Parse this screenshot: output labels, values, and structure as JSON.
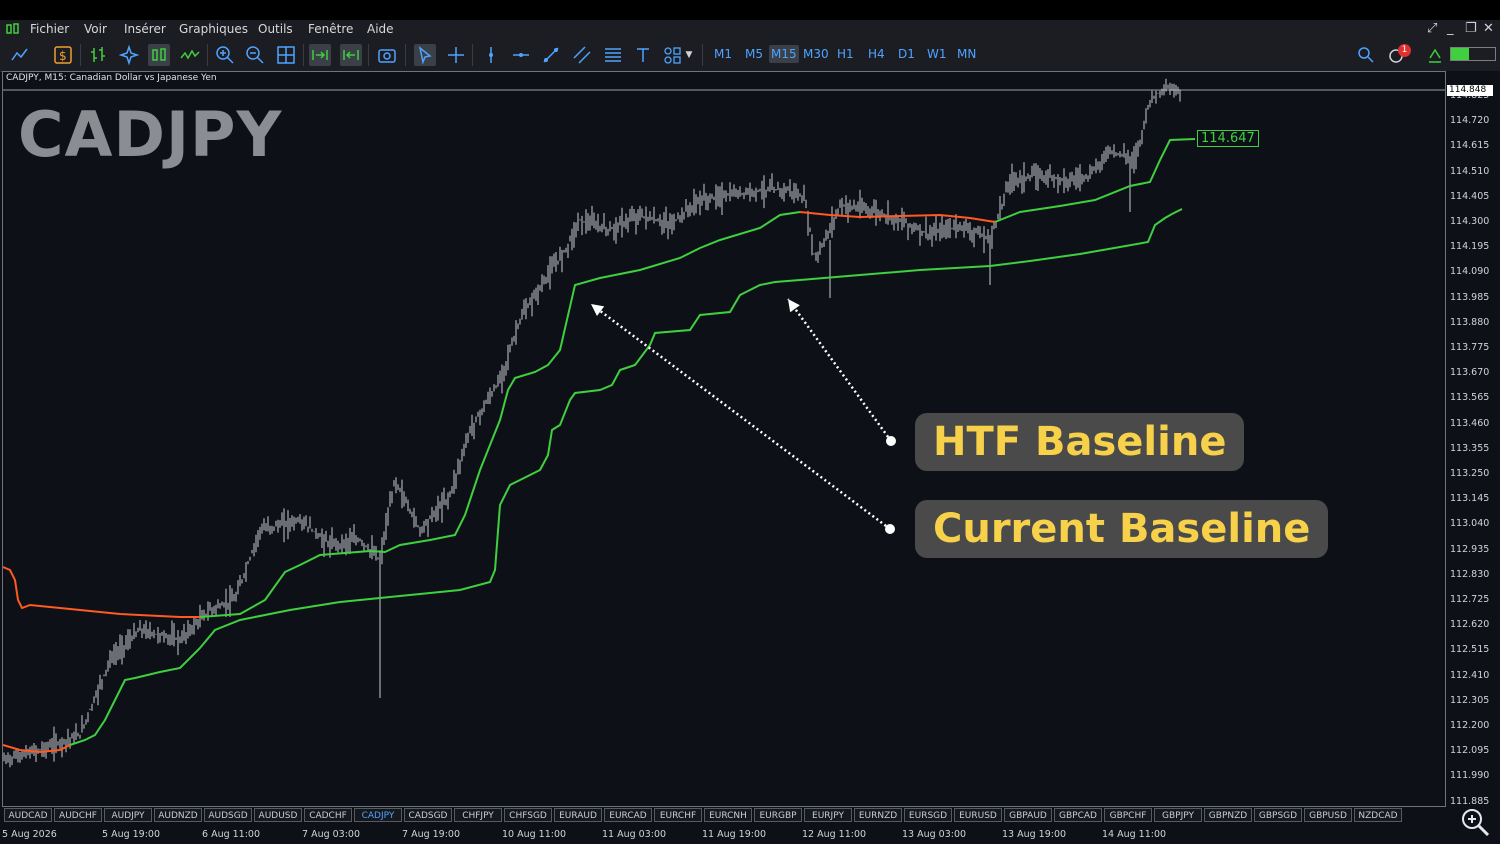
{
  "menu": [
    "Fichier",
    "Voir",
    "Insérer",
    "Graphiques",
    "Outils",
    "Fenêtre",
    "Aide"
  ],
  "timeframes": [
    "M1",
    "M5",
    "M15",
    "M30",
    "H1",
    "H4",
    "D1",
    "W1",
    "MN"
  ],
  "active_timeframe": "M15",
  "notification_count": "1",
  "chart": {
    "info": "CADJPY, M15:  Canadian Dollar vs Japanese Yen",
    "symbol": "CADJPY",
    "current_price": "114.848",
    "baseline_value": "114.647",
    "htf_label": "HTF Baseline",
    "current_label": "Current Baseline"
  },
  "price_axis": [
    "114.825",
    "114.720",
    "114.615",
    "114.510",
    "114.405",
    "114.300",
    "114.195",
    "114.090",
    "113.985",
    "113.880",
    "113.775",
    "113.670",
    "113.565",
    "113.460",
    "113.355",
    "113.250",
    "113.145",
    "113.040",
    "112.935",
    "112.830",
    "112.725",
    "112.620",
    "112.515",
    "112.410",
    "112.305",
    "112.200",
    "112.095",
    "111.990",
    "111.885"
  ],
  "time_axis": [
    "5 Aug 2026",
    "5 Aug 19:00",
    "6 Aug 11:00",
    "7 Aug 03:00",
    "7 Aug 19:00",
    "10 Aug 11:00",
    "11 Aug 03:00",
    "11 Aug 19:00",
    "12 Aug 11:00",
    "13 Aug 03:00",
    "13 Aug 19:00",
    "14 Aug 11:00"
  ],
  "symbol_tabs": [
    "AUDCAD",
    "AUDCHF",
    "AUDJPY",
    "AUDNZD",
    "AUDSGD",
    "AUDUSD",
    "CADCHF",
    "CADJPY",
    "CADSGD",
    "CHFJPY",
    "CHFSGD",
    "EURAUD",
    "EURCAD",
    "EURCHF",
    "EURCNH",
    "EURGBP",
    "EURJPY",
    "EURNZD",
    "EURSGD",
    "EURUSD",
    "GBPAUD",
    "GBPCAD",
    "GBPCHF",
    "GBPJPY",
    "GBPNZD",
    "GBPSGD",
    "GBPUSD",
    "NZDCAD"
  ],
  "active_tab": "CADJPY",
  "colors": {
    "bull_line": "#3fcf3f",
    "bear_line": "#ff5a1f",
    "htf_line": "#3fcf3f",
    "label_text": "#f7d14a",
    "accent": "#4fa3ff"
  }
}
